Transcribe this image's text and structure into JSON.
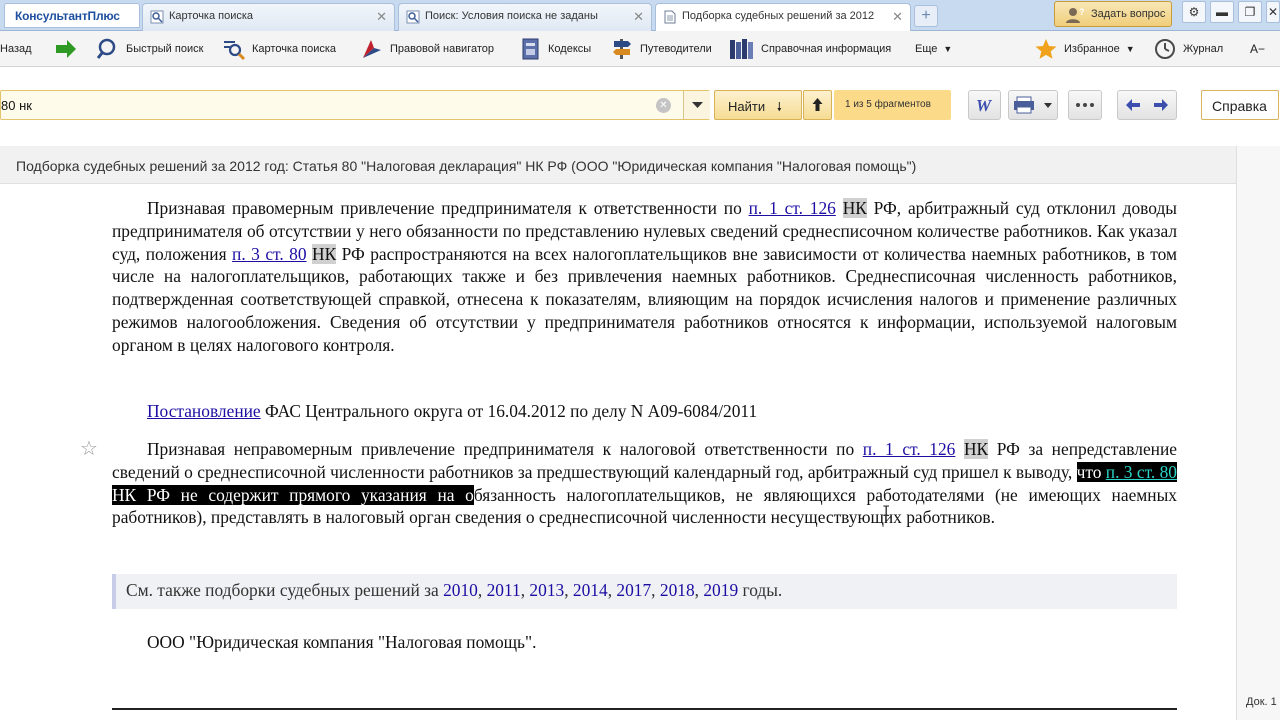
{
  "app": {
    "brand": "КонсультантПлюс"
  },
  "tabs": [
    {
      "label": "Карточка поиска",
      "active": false
    },
    {
      "label": "Поиск: Условия поиска не заданы",
      "active": false
    },
    {
      "label": "Подборка судебных решений за 2012",
      "active": true
    }
  ],
  "header": {
    "ask_label": "Задать вопрос"
  },
  "toolbar": {
    "back": "Назад",
    "quick_search": "Быстрый поиск",
    "search_card": "Карточка поиска",
    "legal_navigator": "Правовой навигатор",
    "codes": "Кодексы",
    "guides": "Путеводители",
    "reference": "Справочная информация",
    "more": "Еще",
    "favorites": "Избранное",
    "journal": "Журнал",
    "font_size": "A−"
  },
  "search": {
    "value": "80 нк",
    "find_label": "Найти",
    "fragments": "1 из 5 фрагментов",
    "help_label": "Справка"
  },
  "doc": {
    "title": "Подборка судебных решений за 2012 год: Статья 80 \"Налоговая декларация\" НК РФ (ООО \"Юридическая компания \"Налоговая помощь\")",
    "p1": {
      "t1": "Признавая правомерным привлечение предпринимателя к ответственности по ",
      "l1": "п. 1 ст. 126",
      "nk1": "НК",
      "t2": " РФ, арбитражный суд отклонил доводы предпринимателя об отсутствии у него обязанности по представлению нулевых сведений среднесписочном количестве работников. Как указал суд, положения ",
      "l2": "п. 3 ст. 80",
      "nk2": "НК",
      "t3": " РФ распространяются на всех налогоплательщиков вне зависимости от количества наемных работников, в том числе на налогоплательщиков, работающих также и без привлечения наемных работников. Среднесписочная численность работников, подтвержденная соответствующей справкой, отнесена к показателям, влияющим на порядок исчисления налогов и применение различных режимов налогообложения. Сведения об отсутствии у предпринимателя работников относятся к информации, используемой налоговым органом в целях налогового контроля."
    },
    "decision": {
      "link": "Постановление",
      "text": " ФАС Центрального округа от 16.04.2012 по делу N А09-6084/2011"
    },
    "p2": {
      "t1": "Признавая неправомерным привлечение предпринимателя к налоговой ответственности по ",
      "l1": "п. 1 ст. 126",
      "nk1": "НК",
      "t2": " РФ за непредставление сведений о среднесписочной численности работников за предшествующий календарный год, арбитражный суд пришел к выводу, ",
      "s1": "что ",
      "l2": "п. 3 ст. 80",
      "s2": " ",
      "nk2": "НК",
      "s3": " РФ не содержит прямого указания на о",
      "t3": "бязанность налогоплательщиков, не являющихся работодателями (не имеющих наемных работников), представлять в налоговый орган сведения о среднесписочной численности несуществующих работников."
    },
    "see_also": {
      "prefix": "См. также подборки судебных решений за ",
      "years": [
        "2010",
        "2011",
        "2013",
        "2014",
        "2017",
        "2018",
        "2019"
      ],
      "sep": ", ",
      "suffix": " годы."
    },
    "company": "ООО \"Юридическая компания \"Налоговая помощь\".",
    "doc_label": "Док. 1"
  }
}
